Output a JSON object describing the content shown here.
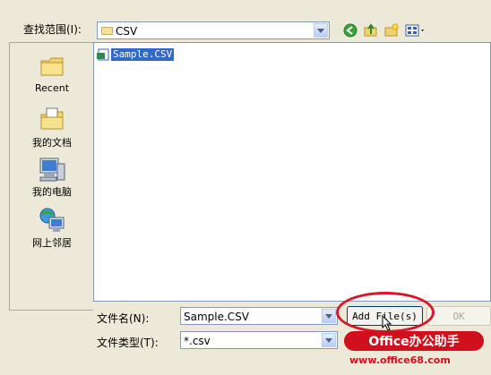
{
  "dialog": {
    "look_in_label": "查找范围(I):",
    "look_in_value": "CSV",
    "places": [
      {
        "label": "Recent",
        "icon": "recent-folder-icon"
      },
      {
        "label": "我的文档",
        "icon": "my-documents-icon"
      },
      {
        "label": "我的电脑",
        "icon": "my-computer-icon"
      },
      {
        "label": "网上邻居",
        "icon": "network-places-icon"
      }
    ],
    "files": [
      {
        "name": "Sample.CSV",
        "selected": true
      }
    ],
    "filename_label": "文件名(N):",
    "filename_value": "Sample.CSV",
    "filetype_label": "文件类型(T):",
    "filetype_value": "*.csv",
    "add_button_label": "Add File(s)",
    "ok_button_label": "OK"
  },
  "watermark": {
    "brand": "Office办公助手",
    "url": "www.office68.com"
  },
  "colors": {
    "dialog_bg": "#ECE9D8",
    "selection": "#316AC5",
    "highlight": "#D8152A"
  }
}
